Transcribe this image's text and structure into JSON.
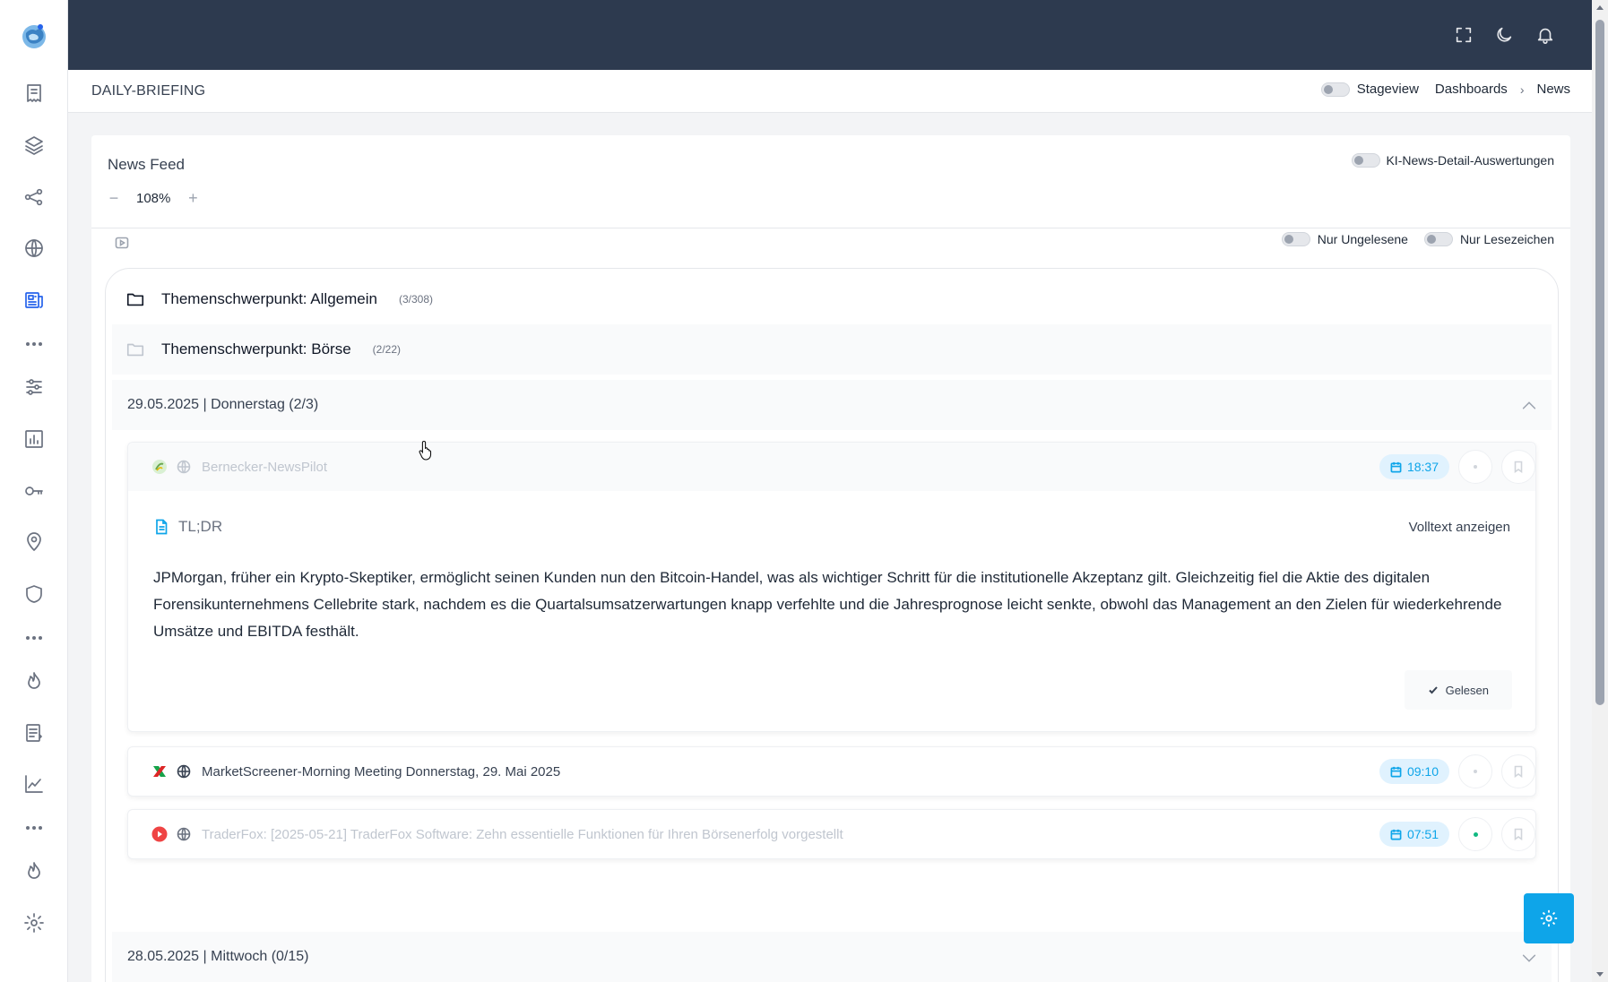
{
  "sidebar": {
    "icons": [
      "receipt-icon",
      "layers-icon",
      "share-nodes-icon",
      "globe-icon",
      "newspaper-icon",
      "sliders-icon",
      "bar-chart-icon",
      "key-icon",
      "map-pin-icon",
      "shield-icon",
      "flame-icon",
      "document-list-icon",
      "line-chart-icon",
      "flame-icon",
      "gear-icon"
    ],
    "active": "newspaper-icon"
  },
  "header": {
    "page_title": "DAILY-BRIEFING",
    "stageview_label": "Stageview",
    "breadcrumb": [
      "Dashboards",
      "News"
    ]
  },
  "feed": {
    "title": "News Feed",
    "zoom": "108%",
    "ki_toggle_label": "KI-News-Detail-Auswertungen",
    "filter_unread": "Nur Ungelesene",
    "filter_bookmarks": "Nur Lesezeichen",
    "folders": [
      {
        "name": "Themenschwerpunkt: Allgemein",
        "count": "(3/308)"
      },
      {
        "name": "Themenschwerpunkt: Börse",
        "count": "(2/22)"
      }
    ],
    "days": [
      {
        "label": "29.05.2025 | Donnerstag (2/3)"
      },
      {
        "label": "28.05.2025 | Mittwoch (0/15)"
      }
    ],
    "items": [
      {
        "source": "Bernecker-NewsPilot",
        "time": "18:37",
        "tldr_label": "TL;DR",
        "fulltext_label": "Volltext anzeigen",
        "summary": "JPMorgan, früher ein Krypto-Skeptiker, ermöglicht seinen Kunden nun den Bitcoin-Handel, was als wichtiger Schritt für die institutionelle Akzeptanz gilt. Gleichzeitig fiel die Aktie des digitalen Forensikunternehmens Cellebrite stark, nachdem es die Quartalsumsatzerwartungen knapp verfehlte und die Jahresprognose leicht senkte, obwohl das Management an den Zielen für wiederkehrende Umsätze und EBITDA festhält.",
        "read_label": "Gelesen"
      },
      {
        "source": "MarketScreener-Morning Meeting Donnerstag, 29. Mai 2025",
        "time": "09:10"
      },
      {
        "source": "TraderFox: [2025-05-21] TraderFox Software: Zehn essentielle Funktionen für Ihren Börsenerfolg vorgestellt",
        "time": "07:51"
      }
    ]
  },
  "colors": {
    "topbar": "#2d3a4f",
    "accent": "#0ea5e9",
    "active_nav": "#2563eb"
  }
}
